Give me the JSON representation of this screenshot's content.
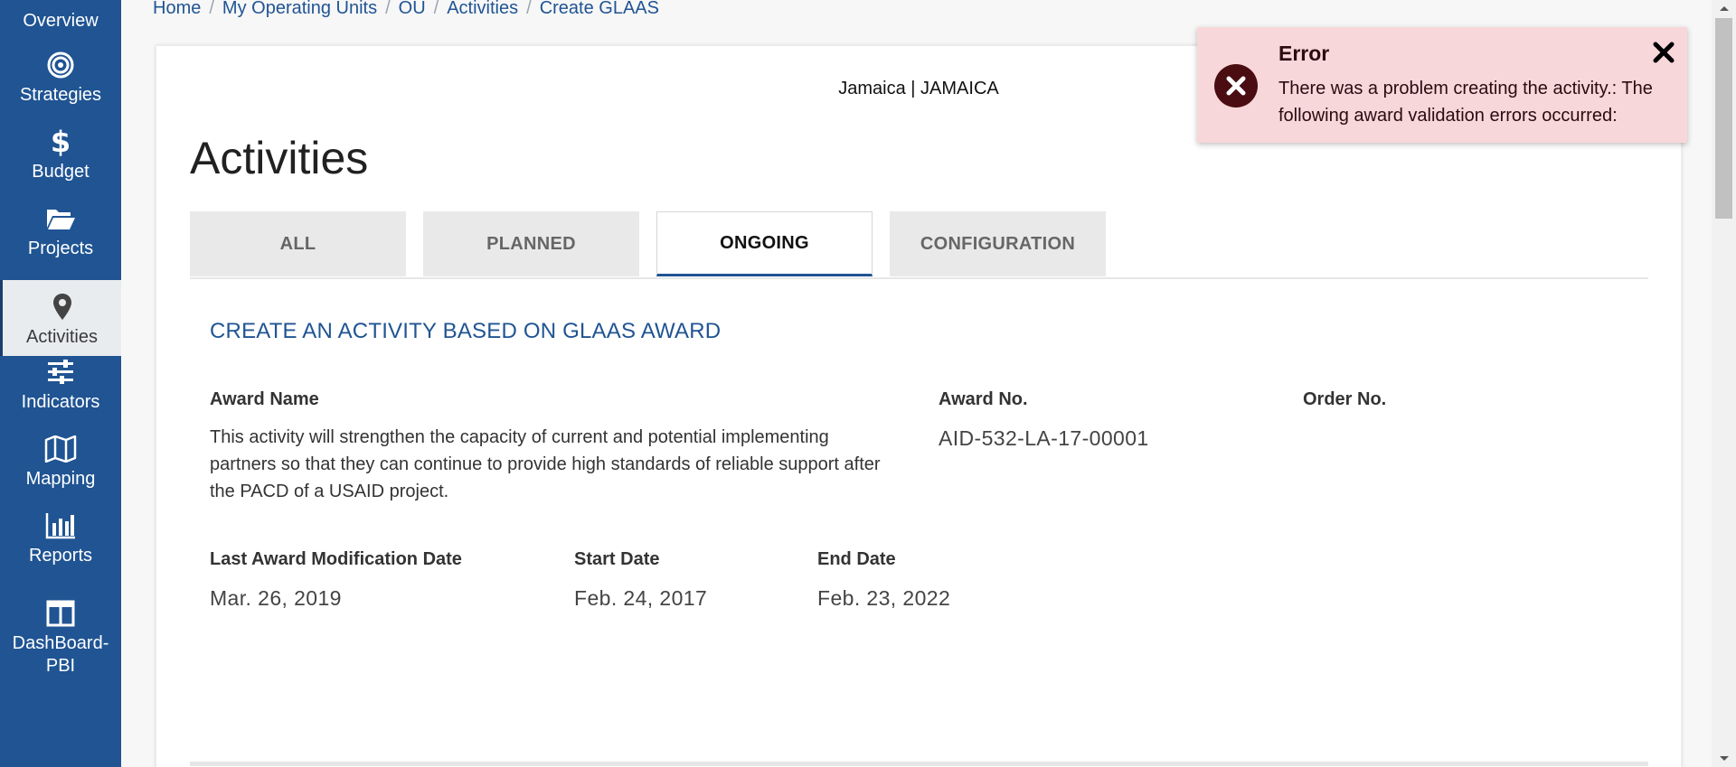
{
  "sidebar": {
    "items": [
      {
        "label": "Overview",
        "icon": "overview-icon"
      },
      {
        "label": "Strategies",
        "icon": "target-icon"
      },
      {
        "label": "Budget",
        "icon": "dollar-icon"
      },
      {
        "label": "Projects",
        "icon": "folder-icon"
      },
      {
        "label": "Activities",
        "icon": "map-pin-icon",
        "active": true
      },
      {
        "label": "Indicators",
        "icon": "sliders-icon"
      },
      {
        "label": "Mapping",
        "icon": "map-icon"
      },
      {
        "label": "Reports",
        "icon": "bar-chart-icon"
      },
      {
        "label": "DashBoard-PBI",
        "icon": "columns-icon"
      }
    ]
  },
  "breadcrumb": [
    "Home",
    "My Operating Units",
    "OU",
    "Activities",
    "Create GLAAS"
  ],
  "header": {
    "ou_label": "Jamaica | JAMAICA",
    "title": "Activities"
  },
  "tabs": [
    {
      "label": "ALL"
    },
    {
      "label": "PLANNED"
    },
    {
      "label": "ONGOING",
      "active": true
    },
    {
      "label": "CONFIGURATION"
    }
  ],
  "award": {
    "section_title": "CREATE AN ACTIVITY BASED ON GLAAS AWARD",
    "award_name_label": "Award Name",
    "award_name_value": "This activity will strengthen the capacity of current and potential implementing partners so that they can continue to provide high standards of reliable support after the PACD of a USAID project.",
    "award_no_label": "Award No.",
    "award_no_value": "AID-532-LA-17-00001",
    "order_no_label": "Order No.",
    "last_mod_label": "Last Award Modification Date",
    "last_mod_value": "Mar. 26, 2019",
    "start_date_label": "Start Date",
    "start_date_value": "Feb. 24, 2017",
    "end_date_label": "End Date",
    "end_date_value": "Feb. 23, 2022"
  },
  "toast": {
    "title": "Error",
    "message": "There was a problem creating the activity.: The following award validation errors occurred:",
    "background_color": "#f8d7da",
    "icon": "error-circle-icon"
  },
  "colors": {
    "sidebar": "#205493",
    "accent": "#205493",
    "active_tab_underline": "#205493"
  }
}
